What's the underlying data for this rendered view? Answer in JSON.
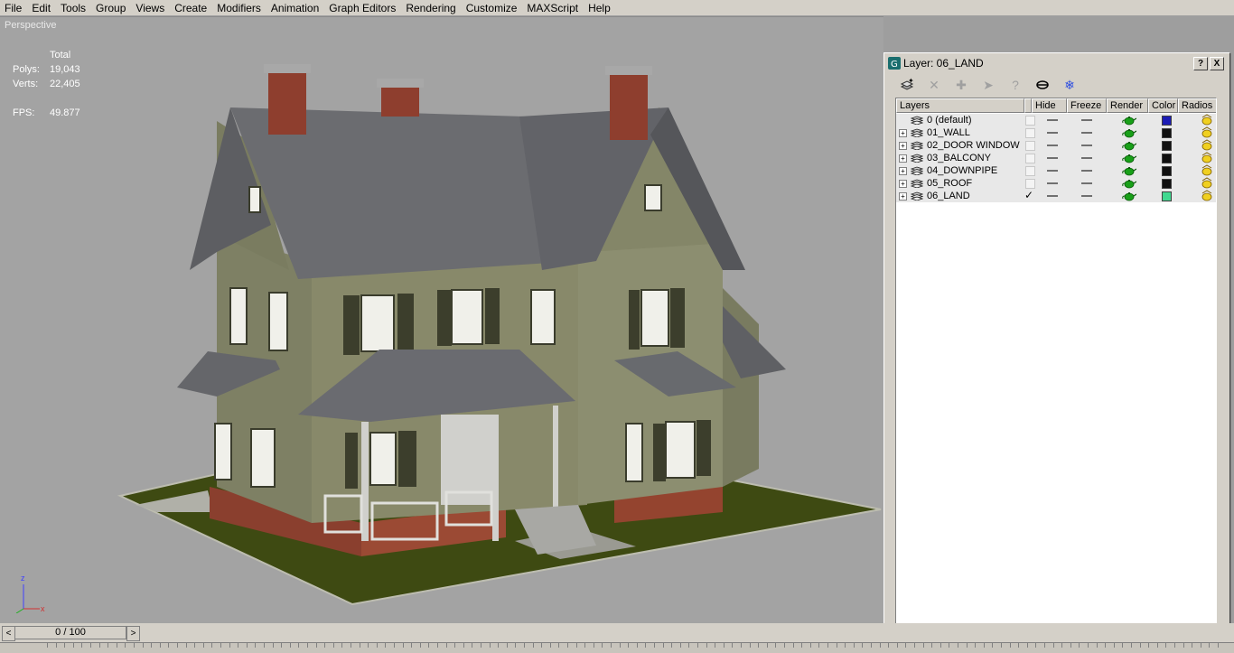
{
  "menu": [
    "File",
    "Edit",
    "Tools",
    "Group",
    "Views",
    "Create",
    "Modifiers",
    "Animation",
    "Graph Editors",
    "Rendering",
    "Customize",
    "MAXScript",
    "Help"
  ],
  "viewport": {
    "label": "Perspective",
    "stats": {
      "total_label": "Total",
      "polys_label": "Polys:",
      "polys": "19,043",
      "verts_label": "Verts:",
      "verts": "22,405",
      "fps_label": "FPS:",
      "fps": "49.877"
    },
    "axis": {
      "z": "z",
      "x": "x"
    }
  },
  "layer_dialog": {
    "title": "Layer: 06_LAND",
    "help_button": "?",
    "close_button": "X",
    "toolbar_icons": [
      "new-layer-icon",
      "delete-layer-icon",
      "add-to-layer-icon",
      "select-highlight-icon",
      "help-icon",
      "hide-all-icon",
      "freeze-all-icon"
    ],
    "columns": {
      "layers": "Layers",
      "hide": "Hide",
      "freeze": "Freeze",
      "render": "Render",
      "color": "Color",
      "radiosity": "Radios"
    },
    "rows": [
      {
        "name": "0 (default)",
        "expandable": false,
        "current": false,
        "color": "#1c1cb4"
      },
      {
        "name": "01_WALL",
        "expandable": true,
        "current": false,
        "color": "#101010"
      },
      {
        "name": "02_DOOR WINDOW",
        "expandable": true,
        "current": false,
        "color": "#101010"
      },
      {
        "name": "03_BALCONY",
        "expandable": true,
        "current": false,
        "color": "#101010"
      },
      {
        "name": "04_DOWNPIPE",
        "expandable": true,
        "current": false,
        "color": "#101010"
      },
      {
        "name": "05_ROOF",
        "expandable": true,
        "current": false,
        "color": "#101010"
      },
      {
        "name": "06_LAND",
        "expandable": true,
        "current": true,
        "color": "#40d890"
      }
    ]
  },
  "timeline": {
    "frame": "0 / 100",
    "prev": "<",
    "next": ">"
  }
}
